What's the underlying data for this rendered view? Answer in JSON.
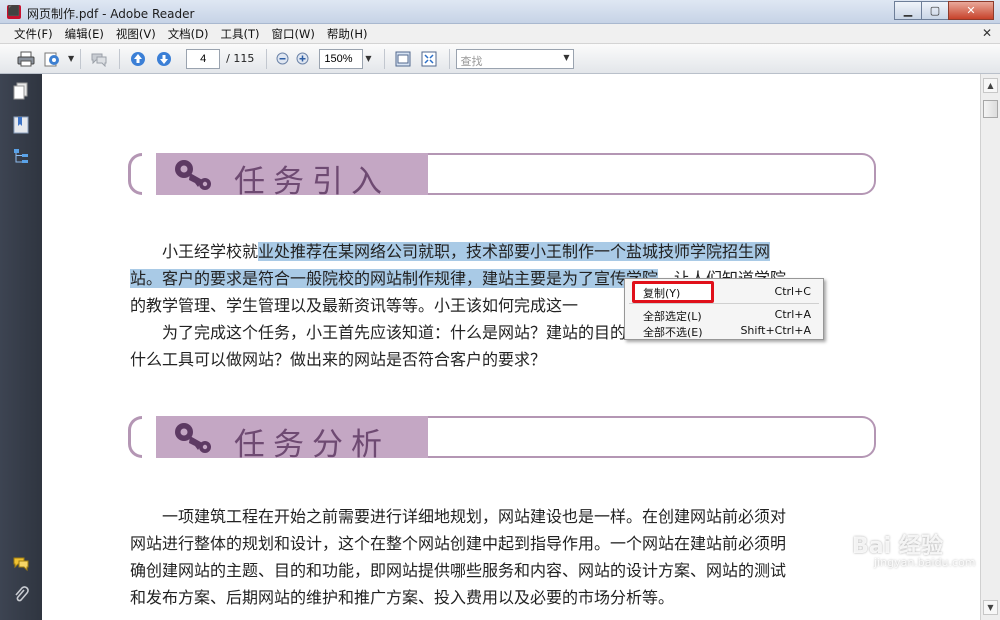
{
  "window": {
    "title": "网页制作.pdf - Adobe Reader",
    "buttons": {
      "minimize": "▁",
      "maximize": "▢",
      "close": "✕"
    }
  },
  "menu": {
    "items": [
      "文件(F)",
      "编辑(E)",
      "视图(V)",
      "文档(D)",
      "工具(T)",
      "窗口(W)",
      "帮助(H)"
    ],
    "close_glyph": "✕"
  },
  "toolbar": {
    "page_current": "4",
    "page_total": "/ 115",
    "zoom": "150%",
    "search_placeholder": "查找"
  },
  "document": {
    "heading1": "任务引入",
    "para1_lines": [
      {
        "pre": "小王经学校就",
        "hl": "业处推荐在某网络公司就职，技术部要小王制作一个盐城技师学院招生网",
        "post": ""
      },
      {
        "pre": "",
        "hl": "站。客户的要求是符合一般院校的网站制作规律，建站主要是为了宣传学院",
        "post": "，让人们知道学院"
      },
      {
        "pre": "的教学管理、学生管理以及最新资讯等等。小王该如何完成这一",
        "hl": "",
        "post": ""
      }
    ],
    "para2_lines": [
      "为了完成这个任务，小王首先应该知道：什么是网站？建站的目的是什么？如何建站？用",
      "什么工具可以做网站？做出来的网站是否符合客户的要求？"
    ],
    "heading2": "任务分析",
    "para3_lines": [
      "一项建筑工程在开始之前需要进行详细地规划，网站建设也是一样。在创建网站前必须对",
      "网站进行整体的规划和设计，这个在整个网站创建中起到指导作用。一个网站在建站前必须明",
      "确创建网站的主题、目的和功能，即网站提供哪些服务和内容、网站的设计方案、网站的测试",
      "和发布方案、后期网站的维护和推广方案、投入费用以及必要的市场分析等。"
    ]
  },
  "context_menu": {
    "items": [
      {
        "label": "复制(Y)",
        "shortcut": "Ctrl+C"
      },
      {
        "label": "全部选定(L)",
        "shortcut": "Ctrl+A"
      },
      {
        "label": "全部不选(E)",
        "shortcut": "Shift+Ctrl+A"
      }
    ]
  },
  "watermark": {
    "main": "Bai 经验",
    "sub": "jingyan.baidu.com"
  },
  "colors": {
    "accent": "#c4a7c4",
    "heading": "#6e4a72",
    "selection": "#a9cae6",
    "highlight_box": "#e0101a"
  }
}
